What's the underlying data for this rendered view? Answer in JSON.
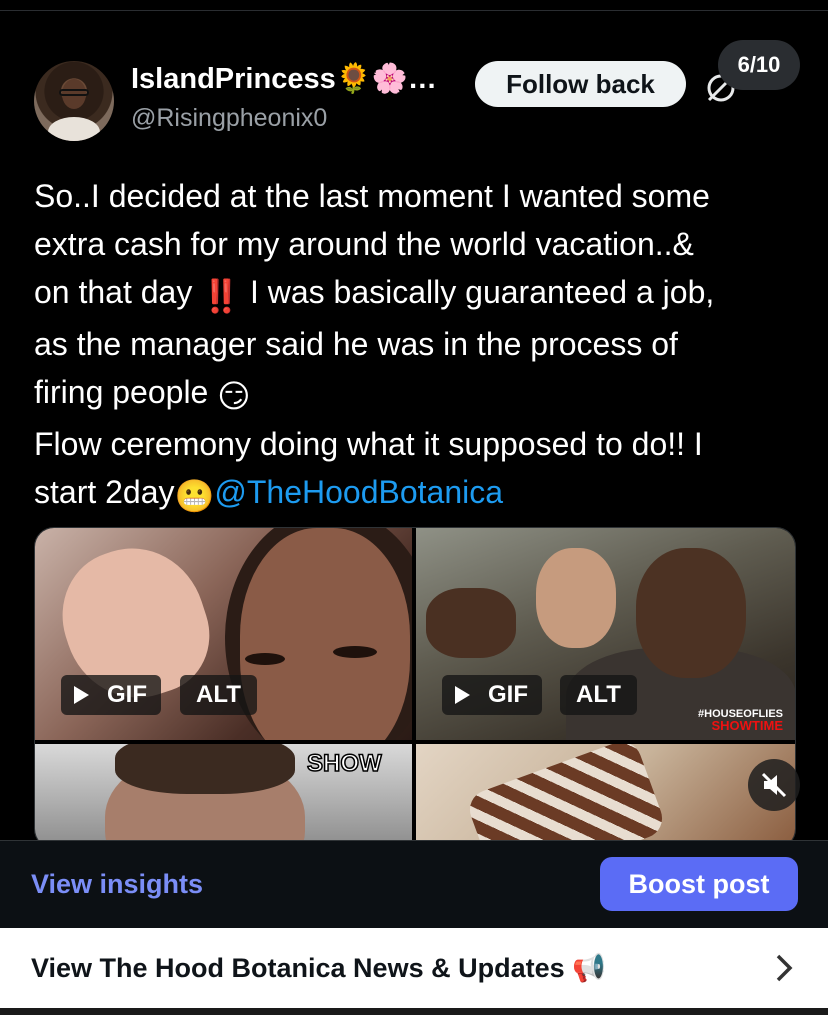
{
  "post": {
    "author_name": "IslandPrincess🌻🌸…",
    "handle": "@Risingpheonix0",
    "follow_label": "Follow back",
    "counter": "6/10",
    "text_lines": [
      "So..I decided at the last moment I wanted some",
      "extra cash for my around the world vacation..&",
      "on that day ",
      " I was basically guaranteed a job,",
      "as the manager said he was in the process of",
      "firing people ",
      "Flow ceremony doing what it supposed to do!! I",
      "start 2day"
    ],
    "emoji_bangbang": "‼️",
    "emoji_smirk": "😏",
    "emoji_grimace": "😬",
    "mention": "@TheHoodBotanica"
  },
  "media": {
    "gif_label": "GIF",
    "alt_label": "ALT",
    "show_text": "SHOW",
    "watermark_top": "#HOUSEOFLIES",
    "watermark_bottom": "SHOWTIME"
  },
  "footer": {
    "insights_label": "View insights",
    "boost_label": "Boost post"
  },
  "news": {
    "label": "View The Hood Botanica News & Updates",
    "icon": "📢"
  },
  "colors": {
    "link": "#1d9bf0",
    "insights": "#7b8ef7",
    "boost": "#5b6cf5"
  }
}
